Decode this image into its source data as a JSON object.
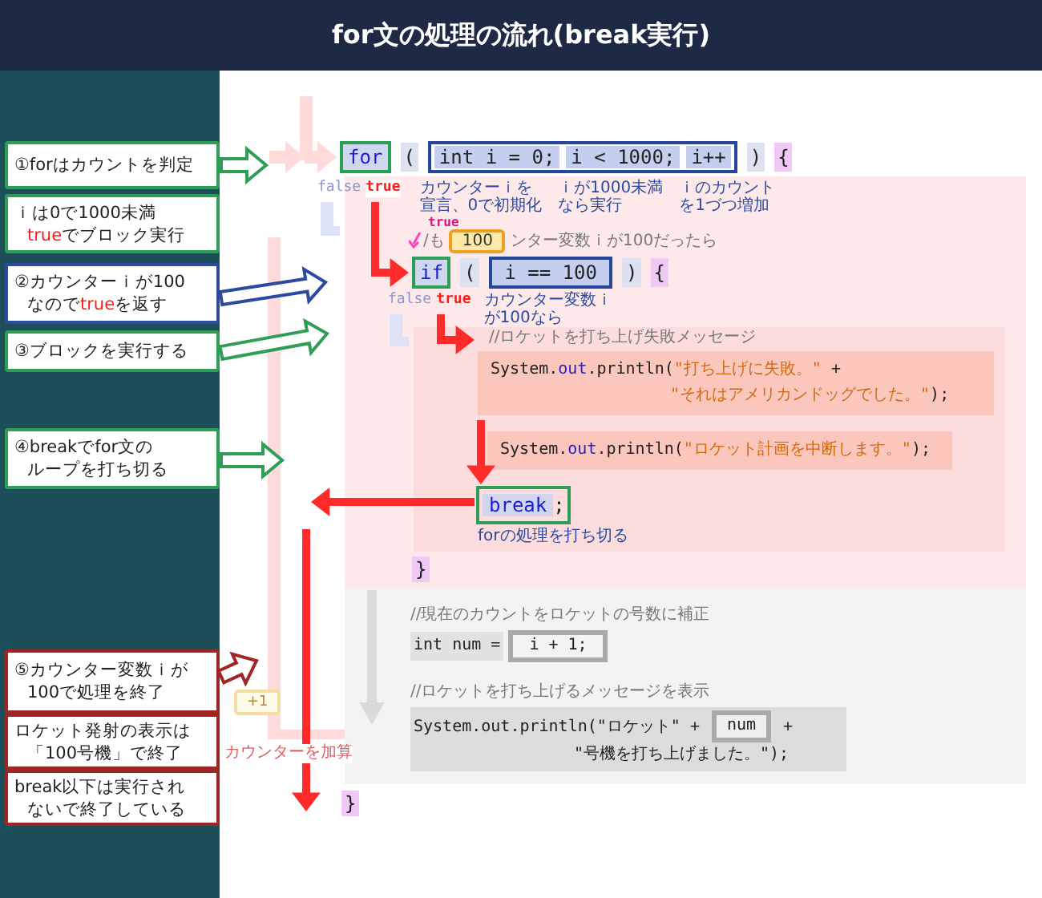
{
  "title": "for文の処理の流れ(break実行)",
  "callouts": [
    {
      "color": "#2e9e57",
      "lines": [
        [
          {
            "text": "①forはカウントを判定",
            "kind": "plain"
          }
        ]
      ]
    },
    {
      "color": "#2e9e57",
      "lines": [
        [
          {
            "text": "ｉは0で1000未満",
            "kind": "plain"
          }
        ],
        [
          {
            "text": "true",
            "kind": "keyword"
          },
          {
            "text": "でブロック実行",
            "kind": "plain"
          }
        ]
      ]
    },
    {
      "color": "#2b4aa0",
      "lines": [
        [
          {
            "text": "②カウンターｉが100",
            "kind": "plain"
          }
        ],
        [
          {
            "text": "なので",
            "kind": "plain"
          },
          {
            "text": "true",
            "kind": "keyword"
          },
          {
            "text": "を返す",
            "kind": "plain"
          }
        ]
      ]
    },
    {
      "color": "#2e9e57",
      "lines": [
        [
          {
            "text": "③ブロックを実行する",
            "kind": "plain"
          }
        ]
      ]
    },
    {
      "color": "#2e9e57",
      "lines": [
        [
          {
            "text": "④breakでfor文の",
            "kind": "plain"
          }
        ],
        [
          {
            "text": "ループを打ち切る",
            "kind": "plain"
          }
        ]
      ]
    },
    {
      "color": "#a02525",
      "lines": [
        [
          {
            "text": "⑤カウンター変数ｉが",
            "kind": "plain"
          }
        ],
        [
          {
            "text": "100で処理を終了",
            "kind": "plain"
          }
        ]
      ]
    },
    {
      "color": "#a02525",
      "lines": [
        [
          {
            "text": "ロケット発射の表示は",
            "kind": "plain"
          }
        ],
        [
          {
            "text": "「100号機」で終了",
            "kind": "plain"
          }
        ]
      ]
    },
    {
      "color": "#a02525",
      "lines": [
        [
          {
            "text": "break以下は実行され",
            "kind": "plain"
          }
        ],
        [
          {
            "text": "ないで終了している",
            "kind": "plain"
          }
        ]
      ]
    }
  ],
  "for_statement": {
    "keyword": "for",
    "open": "(",
    "parts": [
      "int i = 0;",
      "i < 1000;",
      "i++"
    ],
    "close": ")",
    "brace": "{",
    "notes": [
      [
        "カウンターｉを",
        "宣言、0で初期化"
      ],
      [
        "ｉが1000未満",
        "なら実行"
      ],
      [
        "ｉのカウント",
        "を1づつ増加"
      ]
    ],
    "false_label": "false",
    "true_label": "true"
  },
  "if_statement": {
    "comment_before": "/も",
    "comment_after": "ンター変数ｉが100だったら",
    "value_bubble": "100",
    "true_tag": "true",
    "keyword": "if",
    "open": "(",
    "condition": "i == 100",
    "close": ")",
    "brace": "{",
    "note": [
      "カウンター変数ｉ",
      "が100なら"
    ],
    "false_label": "false",
    "true_label": "true",
    "comment": "//ロケットを打ち上げ失敗メッセージ",
    "statements": [
      [
        [
          {
            "text": "System.",
            "kind": "plain"
          },
          {
            "text": "out",
            "kind": "field"
          },
          {
            "text": ".println(",
            "kind": "plain"
          },
          {
            "text": "\"打ち上げに失敗。\"",
            "kind": "string"
          },
          {
            "text": " +",
            "kind": "plain"
          }
        ],
        [
          {
            "text": "\"それはアメリカンドッグでした。\"",
            "kind": "string"
          },
          {
            "text": ");",
            "kind": "plain"
          }
        ]
      ],
      [
        [
          {
            "text": "System.",
            "kind": "plain"
          },
          {
            "text": "out",
            "kind": "field"
          },
          {
            "text": ".println(",
            "kind": "plain"
          },
          {
            "text": "\"ロケット計画を中断します。\"",
            "kind": "string"
          },
          {
            "text": ");",
            "kind": "plain"
          }
        ]
      ]
    ],
    "break_keyword": "break",
    "break_semicolon": ";",
    "break_note": "forの処理を打ち切る",
    "close_brace": "}"
  },
  "after_loop": {
    "comment1": "//現在のカウントをロケットの号数に補正",
    "assign": "int num =",
    "assign_value": "i + 1;",
    "comment2": "//ロケットを打ち上げるメッセージを表示",
    "print_start": "System.out.println(\"ロケット\" +",
    "print_var": "num",
    "print_plus": "+",
    "print_end": "\"号機を打ち上げました。\");"
  },
  "increment_bubble": "+1",
  "increment_label": "カウンターを加算",
  "loop_close": "}"
}
